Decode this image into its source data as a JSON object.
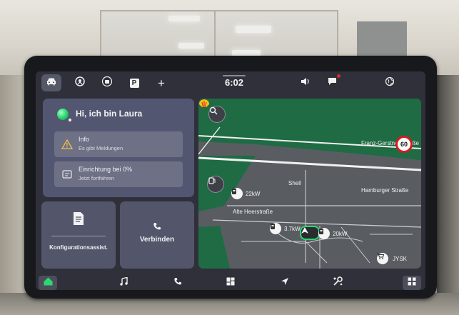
{
  "status_bar": {
    "time": "6:02",
    "icons": [
      "car-icon",
      "steering-assist-icon",
      "camera-car-icon",
      "parking-icon",
      "plus-icon",
      "volume-icon",
      "notification-icon",
      "globe-icon"
    ],
    "parking_label": "P",
    "plus_label": "+"
  },
  "assistant": {
    "greeting": "Hi, ich bin Laura",
    "rows": [
      {
        "title": "Info",
        "subtitle": "Es gibt Meldungen",
        "icon": "warning-icon"
      },
      {
        "title": "Einrichtung bei 0%",
        "subtitle": "Jetzt fortfahren",
        "icon": "setup-icon"
      }
    ]
  },
  "tiles": {
    "config": {
      "label": "Konfigurationsassist.",
      "icon": "document-icon"
    },
    "connect": {
      "label": "Verbinden",
      "icon": "phone-icon"
    }
  },
  "map": {
    "street_franz": "Franz-Gerstner-Straße",
    "street_hamburger": "Hamburger Straße",
    "street_alte": "Alte Heerstraße",
    "poi_shell": "Shell",
    "charger_1": "22kW",
    "charger_2": "3.7kW",
    "charger_3": "20kW",
    "poi_jysk": "JYSK",
    "speed_limit": "60"
  },
  "bottom_bar": {
    "icons": [
      "home-icon",
      "music-icon",
      "phone-icon",
      "dashboard-icon",
      "navigation-icon",
      "settings-icon",
      "apps-icon"
    ]
  },
  "colors": {
    "accent_green": "#2ed673",
    "map_green": "#1e6b44",
    "panel": "#53566a",
    "speed_red": "#d51d1d"
  }
}
